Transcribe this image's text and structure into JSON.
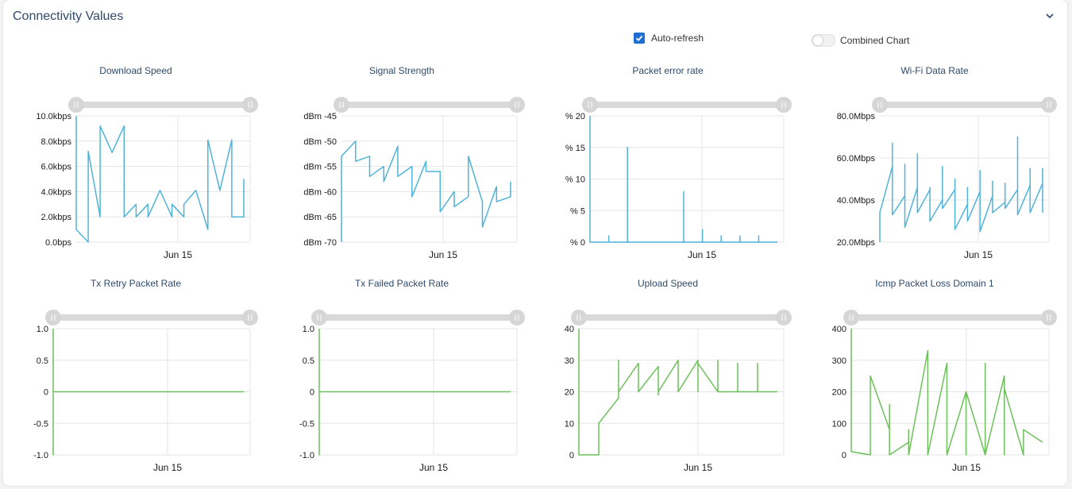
{
  "panel": {
    "title": "Connectivity Values"
  },
  "controls": {
    "auto_refresh_label": "Auto-refresh",
    "auto_refresh_checked": true,
    "combined_chart_label": "Combined Chart",
    "combined_chart_on": false
  },
  "colors": {
    "blue": "#4fb4d8",
    "green": "#6cc05a",
    "grid": "#e5e5e5",
    "slider": "#d9d9d9"
  },
  "icons": {
    "collapse": "chevron-down-icon",
    "checkbox": "check-icon",
    "slider_handle": "slider-handle-icon"
  },
  "chart_data": [
    {
      "type": "line",
      "title": "Download Speed",
      "color": "blue",
      "yticks": [
        "0.0bps",
        "2.0kbps",
        "4.0kbps",
        "6.0kbps",
        "8.0kbps",
        "10.0kbps"
      ],
      "ylim": [
        0,
        10
      ],
      "xlabel_tick": "Jun 15",
      "x": [
        0,
        0,
        1,
        1,
        2,
        2,
        3,
        4,
        4,
        5,
        5,
        6,
        6,
        7,
        8,
        8,
        9,
        9,
        10,
        11,
        11,
        12,
        13,
        13,
        14,
        14
      ],
      "y": [
        10,
        1,
        0,
        7.2,
        2,
        9.2,
        7.1,
        9.2,
        2,
        3,
        2,
        3,
        2,
        4.1,
        2,
        3,
        2,
        3,
        4.1,
        1,
        8.1,
        4.1,
        8.1,
        2,
        2,
        5
      ]
    },
    {
      "type": "line",
      "title": "Signal Strength",
      "color": "blue",
      "yticks": [
        "dBm -70",
        "dBm -65",
        "dBm -60",
        "dBm -55",
        "dBm -50",
        "dBm -45"
      ],
      "ylim": [
        -70,
        -45
      ],
      "xlabel_tick": "Jun 15",
      "x": [
        0,
        0,
        1,
        1,
        2,
        2,
        3,
        3,
        4,
        4,
        5,
        5,
        6,
        6,
        7,
        7,
        8,
        8,
        9,
        9,
        10,
        10,
        11,
        11,
        12,
        12
      ],
      "y": [
        -70,
        -53,
        -50,
        -54,
        -53,
        -57,
        -55,
        -58,
        -51,
        -57,
        -55,
        -61,
        -54,
        -56,
        -56,
        -64,
        -60,
        -63,
        -61,
        -53,
        -62,
        -67,
        -59,
        -62,
        -61,
        -58
      ]
    },
    {
      "type": "line",
      "title": "Packet error rate",
      "color": "blue",
      "yticks": [
        "% 0",
        "% 5",
        "% 10",
        "% 15",
        "% 20"
      ],
      "ylim": [
        0,
        20
      ],
      "xlabel_tick": "Jun 15",
      "x": [
        0,
        0,
        1,
        1,
        1,
        2,
        2,
        2,
        3,
        4,
        5,
        5,
        5,
        6,
        6,
        6,
        7,
        7,
        7,
        8,
        8,
        8,
        9,
        9,
        9,
        10
      ],
      "y": [
        20,
        0,
        0,
        1,
        0,
        0,
        15,
        0,
        0,
        0,
        0,
        8,
        0,
        0,
        2,
        0,
        0,
        1,
        0,
        0,
        1,
        0,
        0,
        1,
        0,
        0
      ]
    },
    {
      "type": "line",
      "title": "Wi-Fi Data Rate",
      "color": "blue",
      "yticks": [
        "20.0Mbps",
        "40.0Mbps",
        "60.0Mbps",
        "80.0Mbps"
      ],
      "ylim": [
        20,
        80
      ],
      "xlabel_tick": "Jun 15",
      "x": [
        0,
        0,
        1,
        1,
        1,
        2,
        2,
        2,
        3,
        3,
        3,
        4,
        4,
        4,
        5,
        5,
        5,
        6,
        6,
        6,
        7,
        7,
        7,
        8,
        8,
        8,
        9,
        9,
        9,
        10,
        10,
        10,
        11,
        11,
        11,
        12,
        12,
        12,
        13,
        13,
        13
      ],
      "y": [
        20,
        34,
        56,
        67,
        33,
        42,
        57,
        27,
        46,
        62,
        34,
        45,
        46,
        30,
        40,
        56,
        36,
        45,
        50,
        26,
        38,
        46,
        30,
        44,
        54,
        25,
        42,
        49,
        34,
        39,
        48,
        36,
        45,
        70,
        33,
        47,
        55,
        34,
        48,
        55,
        34
      ]
    },
    {
      "type": "line",
      "title": "Tx Retry Packet Rate",
      "color": "green",
      "yticks": [
        "-1.0",
        "-0.5",
        "0",
        "0.5",
        "1.0"
      ],
      "ylim": [
        -1,
        1
      ],
      "xlabel_tick": "Jun 15",
      "x": [
        0,
        0,
        0,
        10
      ],
      "y": [
        1,
        -1,
        0,
        0
      ]
    },
    {
      "type": "line",
      "title": "Tx Failed Packet Rate",
      "color": "green",
      "yticks": [
        "-1.0",
        "-0.5",
        "0",
        "0.5",
        "1.0"
      ],
      "ylim": [
        -1,
        1
      ],
      "xlabel_tick": "Jun 15",
      "x": [
        0,
        0,
        0,
        10
      ],
      "y": [
        1,
        -1,
        0,
        0
      ]
    },
    {
      "type": "line",
      "title": "Upload Speed",
      "color": "green",
      "yticks": [
        "0",
        "10",
        "20",
        "30",
        "40"
      ],
      "ylim": [
        0,
        40
      ],
      "xlabel_tick": "Jun 15",
      "x": [
        0,
        0,
        1,
        1,
        2,
        2,
        2,
        3,
        3,
        3,
        4,
        4,
        4,
        5,
        5,
        5,
        6,
        6,
        6,
        7,
        7,
        7,
        8,
        8,
        8,
        9,
        9,
        9,
        10
      ],
      "y": [
        40,
        0,
        0,
        10,
        18,
        30,
        20,
        29,
        20,
        20,
        28,
        19,
        20,
        30,
        20,
        20,
        30,
        20,
        29,
        20,
        30,
        20,
        20,
        29,
        20,
        20,
        29,
        20,
        20
      ]
    },
    {
      "type": "line",
      "title": "Icmp Packet Loss Domain 1",
      "color": "green",
      "yticks": [
        "0",
        "100",
        "200",
        "300",
        "400"
      ],
      "ylim": [
        0,
        400
      ],
      "xlabel_tick": "Jun 15",
      "x": [
        0,
        0,
        1,
        1,
        2,
        2,
        2,
        3,
        3,
        3,
        4,
        4,
        4,
        5,
        5,
        5,
        6,
        6,
        6,
        7,
        7,
        7,
        8,
        8,
        8,
        9,
        9,
        9,
        10
      ],
      "y": [
        400,
        10,
        0,
        250,
        80,
        160,
        0,
        40,
        80,
        0,
        330,
        160,
        0,
        290,
        40,
        0,
        200,
        0,
        200,
        0,
        290,
        0,
        250,
        0,
        210,
        0,
        40,
        80,
        40
      ]
    }
  ]
}
